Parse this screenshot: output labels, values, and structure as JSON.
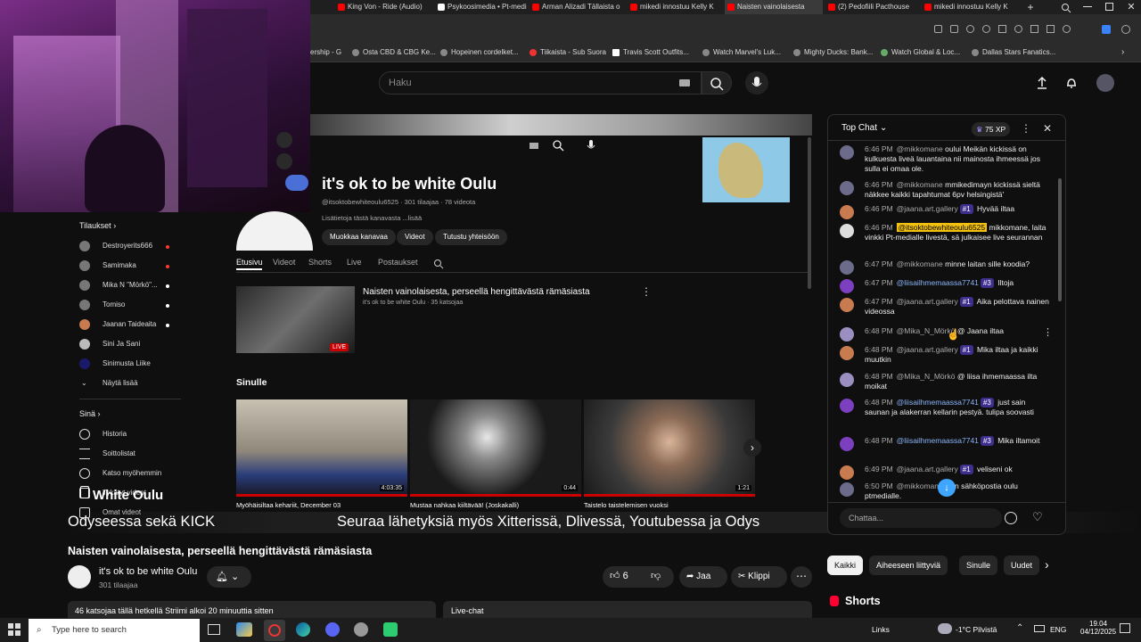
{
  "browser": {
    "tabs": [
      {
        "label": "King Von - Ride (Audio)",
        "color": "#ff0000"
      },
      {
        "label": "Psykoosimedia • Pt-medi",
        "color": "#ffffff"
      },
      {
        "label": "Arman Alizadi Tällaista o",
        "color": "#ff0000"
      },
      {
        "label": "mikedi innostuu Kelly K",
        "color": "#ff0000"
      },
      {
        "label": "Naisten vainolaisesta",
        "color": "#ff0000"
      },
      {
        "label": "(2) Pedofiili Pacthouse",
        "color": "#ff0000"
      },
      {
        "label": "mikedi innostuu Kelly K",
        "color": "#ff0000"
      }
    ],
    "bookmarks": [
      "ership - G",
      "Osta CBD & CBG Ke...",
      "Hopeinen cordelket...",
      "Tiikaista - Sub Suora",
      "Travis Scott Outfits...",
      "Watch Marvel's Luk...",
      "Mighty Ducks: Bank...",
      "Watch Global & Loc...",
      "Dallas Stars Fanatics..."
    ]
  },
  "header": {
    "search_placeholder": "Haku"
  },
  "sidebar": {
    "subscriptions_heading": "Tilaukset",
    "subscriptions": [
      {
        "label": "Destroyerits666",
        "color": "#ff3b30"
      },
      {
        "label": "Samimaka",
        "color": "#ff3b30"
      },
      {
        "label": "Mika N \"Mörkö\"...",
        "color": "#ffffff"
      },
      {
        "label": "Tomiso",
        "color": "#ffffff"
      },
      {
        "label": "Jaanan Taideaita",
        "color": "#ffffff"
      },
      {
        "label": "Sini Ja Sani",
        "color": ""
      },
      {
        "label": "Sinimusta Liike",
        "color": ""
      }
    ],
    "show_more": "Näytä lisää",
    "you_heading": "Sinä",
    "you_items": [
      "Historia",
      "Soittolistat",
      "Katso myöhemmin",
      "Tykätyt videot",
      "Omat videot"
    ]
  },
  "channel": {
    "name": "it's ok to be white Oulu",
    "handle_line": "@itsoktobewhiteoulu6525 · 301 tilaajaa · 78 videota",
    "about": "Lisätietoja tästä kanavasta ...lisää",
    "buttons": [
      "Muokkaa kanavaa",
      "Videot",
      "Tutustu yhteisöön"
    ],
    "tabs": [
      "Etusivu",
      "Videot",
      "Shorts",
      "Live",
      "Postaukset"
    ],
    "live_video": {
      "title": "Naisten vainolaisesta, perseellä hengittävästä rämäsiasta",
      "meta": "it's ok to be white Oulu · 35 katsojaa",
      "badge": "LIVE"
    },
    "for_you_heading": "Sinulle",
    "videos": [
      {
        "title": "Myöhäisiltaa kehariit, December 03",
        "duration": "4:03:35"
      },
      {
        "title": "Mustaa nahkaa kiiltävää! (Joskakalli)",
        "duration": "0:44"
      },
      {
        "title": "Taistelo taistelemisen vuoksi",
        "duration": "1:21"
      }
    ]
  },
  "overlay": {
    "watermark": "White Oulu",
    "ticker_left": "Odyseessa sekä KICK",
    "ticker_right": "Seuraa lähetyksiä myös Xitterissä, Dlivessä, Youtubessa ja Odys"
  },
  "video_info": {
    "title": "Naisten vainolaisesta, perseellä hengittävästä rämäsiasta",
    "channel": "it's ok to be white Oulu",
    "subscribers": "301 tilaajaa",
    "likes": "6",
    "share_label": "Jaa",
    "clip_label": "Klippi",
    "viewers_text": "46 katsojaa tällä hetkellä Striimi alkoi 20 minuuttia sitten",
    "live_chat_label": "Live-chat"
  },
  "chat": {
    "mode": "Top Chat",
    "xp": "75 XP",
    "input_placeholder": "Chattaa...",
    "messages": [
      {
        "time": "6:46 PM",
        "user": "@mikkomane",
        "badge": "",
        "text": "oului Meikän kickissä on kulkuesta liveä lauantaina nii mainosta ihmeessä jos sulla ei omaa ole.",
        "avatar": "#6c6c8a"
      },
      {
        "time": "6:46 PM",
        "user": "@mikkomane",
        "badge": "",
        "text": "mmikedimayn kickissä sieltä näkkee kaikki tapahtumat 6pv helsingistä'",
        "avatar": "#6c6c8a"
      },
      {
        "time": "6:46 PM",
        "user": "@jaana.art.gallery",
        "badge": "#1",
        "text": "Hyvää iltaa",
        "avatar": "#c77b4f"
      },
      {
        "time": "6:46 PM",
        "user": "@itsoktobewhiteoulu6525",
        "badge": "",
        "text": "mikkomane, laita vinkki Pt-medialle livestä, sä julkaisee live seurannan",
        "avatar": "#dddddd",
        "highlight": true
      },
      {
        "time": "6:47 PM",
        "user": "@mikkomane",
        "badge": "",
        "text": "minne laitan sille koodia?",
        "avatar": "#6c6c8a"
      },
      {
        "time": "6:47 PM",
        "user": "@liisailhmemaassa7741",
        "badge": "#3",
        "text": "Iltoja",
        "avatar": "#7b3fbf"
      },
      {
        "time": "6:47 PM",
        "user": "@jaana.art.gallery",
        "badge": "#1",
        "text": "Aika pelottava nainen videossa",
        "avatar": "#c77b4f"
      },
      {
        "time": "6:48 PM",
        "user": "@Mika_N_Mörkö",
        "badge": "",
        "text": "@ Jaana iltaa",
        "avatar": "#9a8fc0"
      },
      {
        "time": "6:48 PM",
        "user": "@jaana.art.gallery",
        "badge": "#1",
        "text": "Mika iltaa ja kaikki muutkin",
        "avatar": "#c77b4f"
      },
      {
        "time": "6:48 PM",
        "user": "@Mika_N_Mörkö",
        "badge": "",
        "text": "@ liisa ihmemaassa ilta moikat",
        "avatar": "#9a8fc0"
      },
      {
        "time": "6:48 PM",
        "user": "@liisailhmemaassa7741",
        "badge": "#3",
        "text": "just sain saunan ja alakerran kellarin pestyä. tulipa soovasti",
        "avatar": "#7b3fbf"
      },
      {
        "time": "6:48 PM",
        "user": "@liisailhmemaassa7741",
        "badge": "#3",
        "text": "Mika iltamoit",
        "avatar": "#7b3fbf"
      },
      {
        "time": "6:49 PM",
        "user": "@jaana.art.gallery",
        "badge": "#1",
        "text": "veliseni ok",
        "avatar": "#c77b4f"
      },
      {
        "time": "6:50 PM",
        "user": "@mikkomane",
        "badge": "",
        "text": "soin sähköpostia oulu ptmedialle.",
        "avatar": "#6c6c8a"
      }
    ]
  },
  "filter_chips": [
    "Kaikki",
    "Aiheeseen liittyviä",
    "Sinulle",
    "Uudet"
  ],
  "shorts_heading": "Shorts",
  "taskbar": {
    "search_placeholder": "Type here to search",
    "links_label": "Links",
    "weather": "-1°C Pilvistä",
    "language": "ENG",
    "time": "19.04",
    "date": "04/12/2025"
  }
}
